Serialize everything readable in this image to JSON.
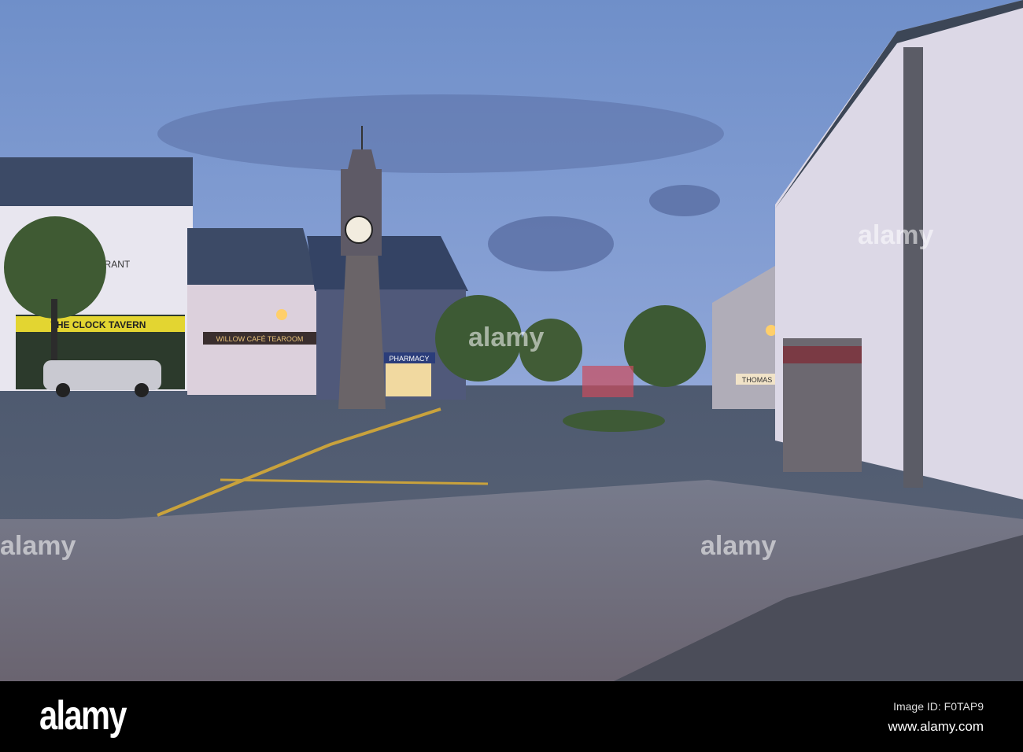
{
  "photo": {
    "signs": {
      "restaurant": "RESTAURANT",
      "tavern": "THE CLOCK TAVERN",
      "cafe": "WILLOW CAFÉ TEAROOM",
      "pharmacy": "PHARMACY",
      "thomas": "THOMAS"
    }
  },
  "watermark": {
    "text": "alamy",
    "image_id": "Image ID: F0TAP9",
    "url": "www.alamy.com"
  }
}
